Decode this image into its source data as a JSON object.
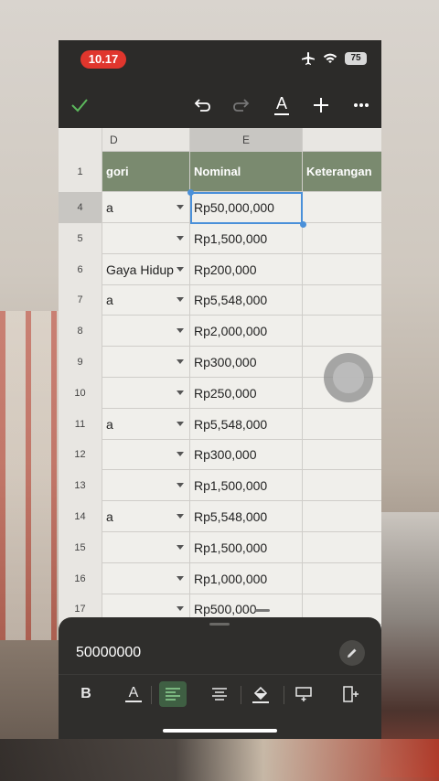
{
  "status": {
    "time": "10.17",
    "battery": "75"
  },
  "toolbar": {
    "done_icon": "check-icon",
    "undo_icon": "undo-icon",
    "redo_icon": "redo-icon",
    "text_format_label": "A",
    "add_icon": "plus-icon",
    "more_icon": "more-icon"
  },
  "columns": {
    "d": "D",
    "e": "E"
  },
  "header": {
    "row": "1",
    "d": "gori",
    "e": "Nominal",
    "f": "Keterangan"
  },
  "rows": [
    {
      "row": "4",
      "d": "a",
      "e": "Rp50,000,000"
    },
    {
      "row": "5",
      "d": "",
      "e": "Rp1,500,000"
    },
    {
      "row": "6",
      "d": "Gaya Hidup",
      "e": "Rp200,000"
    },
    {
      "row": "7",
      "d": "a",
      "e": "Rp5,548,000"
    },
    {
      "row": "8",
      "d": "",
      "e": "Rp2,000,000"
    },
    {
      "row": "9",
      "d": "",
      "e": "Rp300,000"
    },
    {
      "row": "10",
      "d": "",
      "e": "Rp250,000"
    },
    {
      "row": "11",
      "d": "a",
      "e": "Rp5,548,000"
    },
    {
      "row": "12",
      "d": "",
      "e": "Rp300,000"
    },
    {
      "row": "13",
      "d": "",
      "e": "Rp1,500,000"
    },
    {
      "row": "14",
      "d": "a",
      "e": "Rp5,548,000"
    },
    {
      "row": "15",
      "d": "",
      "e": "Rp1,500,000"
    },
    {
      "row": "16",
      "d": "",
      "e": "Rp1,000,000"
    },
    {
      "row": "17",
      "d": "",
      "e": "Rp500,000"
    }
  ],
  "formula_bar": {
    "value": "50000000"
  },
  "format": {
    "bold_label": "B",
    "text_color_label": "A"
  },
  "colors": {
    "header_fill": "#7a8a6f",
    "selection": "#4a90d9",
    "accent_check": "#5cb85c"
  }
}
